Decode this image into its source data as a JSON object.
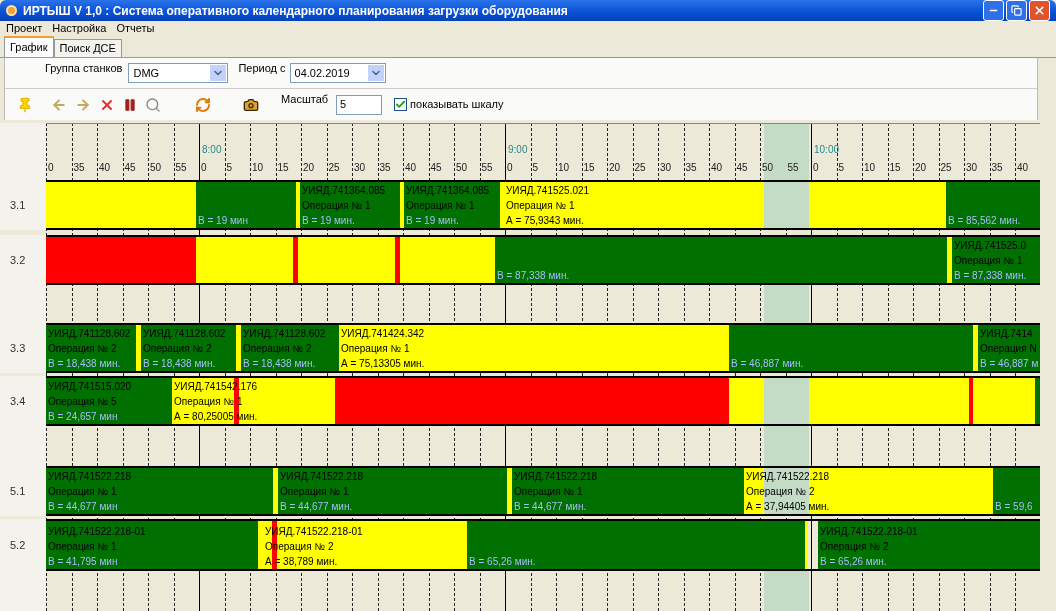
{
  "window": {
    "title": "ИРТЫШ V 1,0 : Система оперативного календарного планирования загрузки оборудования"
  },
  "menu": [
    "Проект",
    "Настройка",
    "Отчеты"
  ],
  "tabs": [
    {
      "label": "График",
      "selected": true
    },
    {
      "label": "Поиск ДСЕ",
      "selected": false
    }
  ],
  "filters": {
    "group_label": "Группа станков",
    "group_value": "DMG",
    "period_label": "Период с",
    "period_value": "04.02.2019",
    "scale_label": "Масштаб",
    "scale_value": "5",
    "show_scale": {
      "label": "показывать шкалу",
      "checked": true
    }
  },
  "axis": {
    "hour_labels": [
      "8:00",
      "9:00",
      "10:00"
    ],
    "minute_labels": [
      "0",
      "35",
      "40",
      "45",
      "50",
      "55",
      "0",
      "5",
      "10",
      "15",
      "20",
      "25",
      "30",
      "35",
      "40",
      "45",
      "50",
      "55",
      "0",
      "5",
      "10",
      "15",
      "20",
      "25",
      "30",
      "35",
      "40",
      "45",
      "50",
      "55",
      "0",
      "5",
      "10",
      "15",
      "20",
      "25",
      "30",
      "35",
      "40"
    ]
  },
  "rows": [
    {
      "kind": "machine",
      "label": "3.1",
      "bars": [
        {
          "color": "#ffff00"
        },
        {
          "color": "#007000",
          "duration": "В = 19 мин"
        },
        {
          "color": "#ffff00"
        },
        {
          "color": "#007000",
          "part": "УИЯД.741364.085",
          "operation": "Операция № 1",
          "duration": "В = 19 мин."
        },
        {
          "color": "#ffff00"
        },
        {
          "color": "#007000",
          "part": "УИЯД.741364.085",
          "operation": "Операция № 1",
          "duration": "В = 19 мин."
        },
        {
          "color": "#ffff00"
        },
        {
          "color": "#ffff00",
          "part": "УИЯД.741525.021",
          "operation": "Операция № 1",
          "duration": "А = 75,9343 мин."
        },
        {
          "color": "#007000",
          "duration": "В = 85,562 мин."
        }
      ]
    },
    {
      "kind": "machine",
      "label": "3.2",
      "bars": [
        {
          "color": "#ff0000"
        },
        {
          "color": "#ffff00"
        },
        {
          "color": "#ff0000"
        },
        {
          "color": "#ffff00"
        },
        {
          "color": "#ff0000"
        },
        {
          "color": "#ffff00"
        },
        {
          "color": "#007000",
          "duration": "В = 87,338 мин."
        },
        {
          "color": "#ffff00"
        },
        {
          "color": "#007000",
          "part": "УИЯД.741525.0",
          "operation": "Операция № 1",
          "duration": "В = 87,338 мин."
        }
      ]
    },
    {
      "kind": "spacer"
    },
    {
      "kind": "machine",
      "label": "3.3",
      "bars": [
        {
          "color": "#007000",
          "part": "УИЯД.741128.602",
          "operation": "Операция № 2",
          "duration": "В = 18,438 мин."
        },
        {
          "color": "#ffff00"
        },
        {
          "color": "#007000",
          "part": "УИЯД.741128.602",
          "operation": "Операция № 2",
          "duration": "В = 18,438 мин."
        },
        {
          "color": "#ffff00"
        },
        {
          "color": "#007000",
          "part": "УИЯД.741128.602",
          "operation": "Операция № 2",
          "duration": "В = 18,438 мин."
        },
        {
          "color": "#ffff00",
          "part": "УИЯД.741424.342",
          "operation": "Операция № 1",
          "duration": "А = 75,13305 мин."
        },
        {
          "color": "#007000",
          "duration": "В = 46,887 мин."
        },
        {
          "color": "#ffff00"
        },
        {
          "color": "#007000",
          "part": "УИЯД.7414",
          "operation": "Операция N",
          "duration": "В = 46,887 м"
        }
      ]
    },
    {
      "kind": "machine",
      "label": "3.4",
      "bars": [
        {
          "color": "#007000",
          "part": "УИЯД.741515.020",
          "operation": "Операция № 5",
          "duration": "В = 24,657 мин"
        },
        {
          "color": "#ffff00",
          "part": "УИЯД.741542.176",
          "operation": "Операция № 1",
          "duration": "А = 80,25005 мин."
        },
        {
          "color": "#ff0000"
        },
        {
          "color": "#ff0000"
        },
        {
          "color": "#ffff00"
        },
        {
          "color": "#ff0000"
        },
        {
          "color": "#ffff00"
        },
        {
          "color": "#007000"
        }
      ]
    },
    {
      "kind": "spacer"
    },
    {
      "kind": "machine",
      "label": "5.1",
      "bars": [
        {
          "color": "#007000",
          "part": "УИЯД.741522.218",
          "operation": "Операция № 1",
          "duration": "В = 44,677 мин"
        },
        {
          "color": "#ffff00"
        },
        {
          "color": "#007000",
          "part": "УИЯД.741522.218",
          "operation": "Операция № 1",
          "duration": "В = 44,677 мин."
        },
        {
          "color": "#ffff00"
        },
        {
          "color": "#007000",
          "part": "УИЯД.741522.218",
          "operation": "Операция № 1",
          "duration": "В = 44,677 мин."
        },
        {
          "color": "#ffff00",
          "part": "УИЯД.741522.218",
          "operation": "Операция № 2",
          "duration": "А = 37,94405 мин."
        },
        {
          "color": "#007000",
          "duration": "В = 59,6"
        }
      ]
    },
    {
      "kind": "machine",
      "label": "5.2",
      "bars": [
        {
          "color": "#007000",
          "part": "УИЯД.741522.218-01",
          "operation": "Операция № 1",
          "duration": "В = 41,795 мин"
        },
        {
          "color": "#ffff00"
        },
        {
          "color": "#ffff00",
          "part": "УИЯД.741522.218-01",
          "operation": "Операция № 2",
          "duration": "А = 38,789 мин."
        },
        {
          "color": "#ff0000"
        },
        {
          "color": "#007000",
          "duration": "В = 65,26 мин."
        },
        {
          "color": "#ffff00"
        },
        {
          "color": "#007000",
          "part": "УИЯД.741522.218-01",
          "operation": "Операция № 2",
          "duration": "В = 65,26 мин."
        }
      ]
    },
    {
      "kind": "spacer"
    }
  ]
}
